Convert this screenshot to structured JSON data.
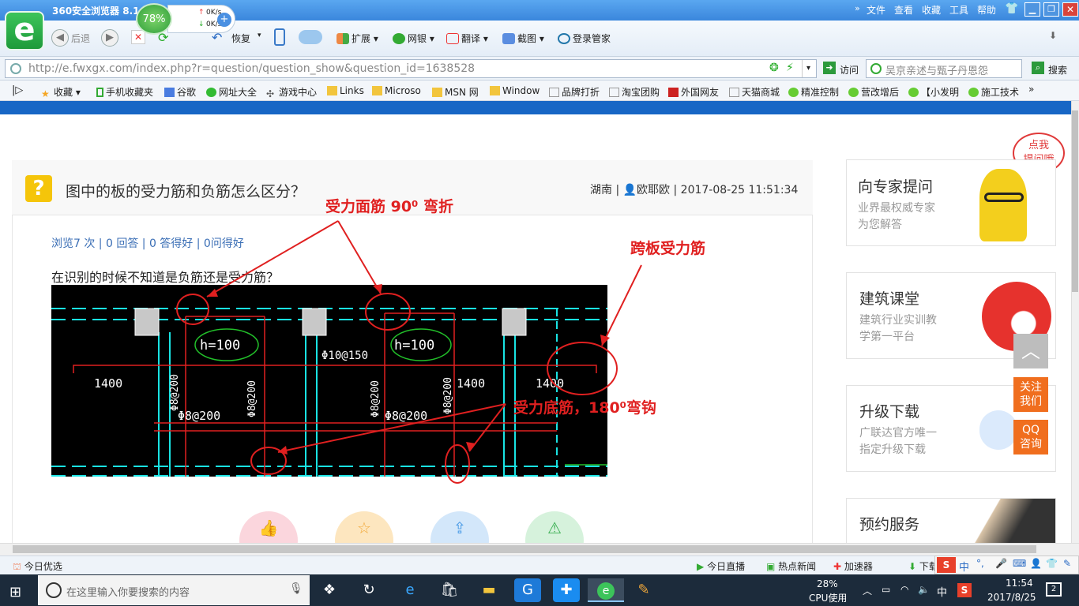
{
  "browser": {
    "app_title": "360安全浏览器 8.1",
    "speed_percent": "78%",
    "up_speed": "0K/s",
    "down_speed": "0K/s",
    "menu": [
      "文件",
      "查看",
      "收藏",
      "工具",
      "帮助"
    ],
    "back_label": "后退",
    "restore_label": "恢复",
    "toolbar_items": [
      "扩展",
      "网银",
      "翻译",
      "截图",
      "登录管家"
    ],
    "url": "http://e.fwxgx.com/index.php?r=question/question_show&question_id=1638528",
    "go_label": "访问",
    "search_placeholder": "吴京亲述与甄子丹恩怨",
    "search_label": "搜索",
    "bookmarks": [
      "收藏",
      "手机收藏夹",
      "谷歌",
      "网址大全",
      "游戏中心",
      "Links",
      "Microso",
      "MSN 网",
      "Window",
      "品牌打折",
      "淘宝团购",
      "外国网友",
      "天猫商城",
      "精准控制",
      "营改增后",
      "【小发明",
      "施工技术"
    ]
  },
  "question": {
    "title": "图中的板的受力筋和负筋怎么区分？",
    "meta": "湖南 | 👤欧耶欧 | 2017-08-25 11:51:34",
    "stats": "浏览7 次 | 0 回答 | 0 答得好 | 0问得好",
    "text": "在识别的时候不知道是负筋还是受力筋？"
  },
  "drawing": {
    "labels": [
      "h=100",
      "h=100",
      "Φ10@150",
      "1400",
      "1400",
      "1400",
      "1400",
      "Φ8@200",
      "Φ8@200",
      "Φ8@200",
      "Φ8@200",
      "Φ8@200",
      "Φ8@200"
    ]
  },
  "annotations": {
    "top": "受力面筋    90⁰  弯折",
    "right": "跨板受力筋",
    "bottom": "受力底筋，180⁰弯钩"
  },
  "actions": [
    "👍",
    "☆",
    "⇪",
    "⚠"
  ],
  "sidebar": {
    "bubble": "点我\n提问哦",
    "cards": [
      {
        "title": "向专家提问",
        "sub1": "业界最权威专家",
        "sub2": "为您解答"
      },
      {
        "title": "建筑课堂",
        "sub1": "建筑行业实训教",
        "sub2": "学第一平台"
      },
      {
        "title": "升级下载",
        "sub1": "广联达官方唯一",
        "sub2": "指定升级下载"
      },
      {
        "title": "预约服务",
        "sub1": "",
        "sub2": ""
      }
    ],
    "follow": "关注\n我们",
    "qq": "QQ\n咨询"
  },
  "statusbar": {
    "left": "今日优选",
    "items": [
      "今日直播",
      "热点新闻",
      "加速器",
      "下载"
    ]
  },
  "taskbar": {
    "search_placeholder": "在这里输入你要搜索的内容",
    "cpu_percent": "28%",
    "cpu_label": "CPU使用",
    "ime": "中",
    "time": "11:54",
    "date": "2017/8/25",
    "notifications": "2"
  },
  "colors": {
    "title_blue": "#3a86dc",
    "annotation_red": "#e02020",
    "accent_orange": "#f06e1e",
    "cad_cyan": "#19e3e3"
  }
}
